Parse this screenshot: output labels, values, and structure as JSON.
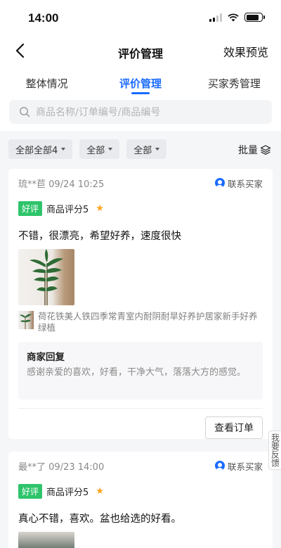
{
  "status_bar": {
    "time": "14:00"
  },
  "nav": {
    "title": "评价管理",
    "right_action": "效果预览"
  },
  "tabs": [
    {
      "label": "整体情况",
      "active": false
    },
    {
      "label": "评价管理",
      "active": true
    },
    {
      "label": "买家秀管理",
      "active": false
    }
  ],
  "search": {
    "placeholder": "商品名称/订单编号/商品编号"
  },
  "filters": [
    {
      "label": "全部全部4"
    },
    {
      "label": "全部"
    },
    {
      "label": "全部"
    }
  ],
  "batch_label": "批量",
  "reviews": [
    {
      "buyer": "琉**苣",
      "time": "09/24 10:25",
      "contact_label": "联系买家",
      "tag": "好评",
      "rating_label": "商品评分5",
      "star": "★",
      "text": "不错，很漂亮，希望好养，速度很快",
      "product_name": "荷花铁美人铁四季常青室内耐阴耐旱好养护居家新手好养绿植",
      "reply_title": "商家回复",
      "reply_text": "感谢亲爱的喜欢，好看，干净大气，落落大方的感觉。",
      "action_label": "查看订单"
    },
    {
      "buyer": "最**了",
      "time": "09/23 14:00",
      "contact_label": "联系买家",
      "tag": "好评",
      "rating_label": "商品评分5",
      "star": "★",
      "text": "真心不错，喜欢。盆也给选的好看。"
    }
  ],
  "feedback_label": "我要反馈",
  "colors": {
    "accent": "#1a6cff",
    "good_tag": "#2fc46b",
    "star": "#ffa41b"
  }
}
